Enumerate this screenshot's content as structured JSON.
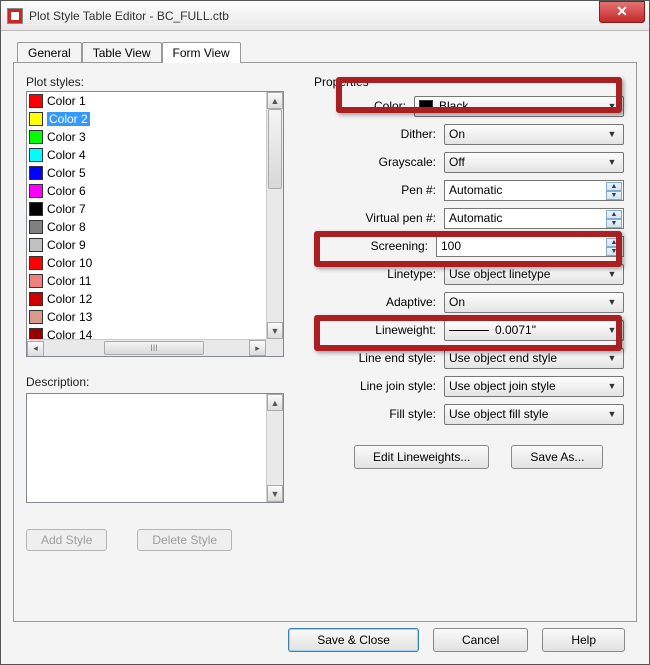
{
  "window": {
    "title": "Plot Style Table Editor - BC_FULL.ctb"
  },
  "tabs": {
    "general": "General",
    "table_view": "Table View",
    "form_view": "Form View"
  },
  "left": {
    "plot_styles_label": "Plot styles:",
    "description_label": "Description:",
    "add_style": "Add Style",
    "delete_style": "Delete Style",
    "items": [
      {
        "name": "Color 1",
        "color": "#ff0000"
      },
      {
        "name": "Color 2",
        "color": "#ffff00"
      },
      {
        "name": "Color 3",
        "color": "#00ff00"
      },
      {
        "name": "Color 4",
        "color": "#00ffff"
      },
      {
        "name": "Color 5",
        "color": "#0000ff"
      },
      {
        "name": "Color 6",
        "color": "#ff00ff"
      },
      {
        "name": "Color 7",
        "color": "#000000"
      },
      {
        "name": "Color 8",
        "color": "#808080"
      },
      {
        "name": "Color 9",
        "color": "#c0c0c0"
      },
      {
        "name": "Color 10",
        "color": "#ff0000"
      },
      {
        "name": "Color 11",
        "color": "#f08080"
      },
      {
        "name": "Color 12",
        "color": "#cc0000"
      },
      {
        "name": "Color 13",
        "color": "#d9998c"
      },
      {
        "name": "Color 14",
        "color": "#990000"
      }
    ],
    "selected_index": 1
  },
  "props": {
    "section_label": "Properties",
    "color_label": "Color:",
    "color_value": "Black",
    "dither_label": "Dither:",
    "dither_value": "On",
    "grayscale_label": "Grayscale:",
    "grayscale_value": "Off",
    "pen_label": "Pen #:",
    "pen_value": "Automatic",
    "vpen_label": "Virtual pen #:",
    "vpen_value": "Automatic",
    "screening_label": "Screening:",
    "screening_value": "100",
    "linetype_label": "Linetype:",
    "linetype_value": "Use object linetype",
    "adaptive_label": "Adaptive:",
    "adaptive_value": "On",
    "lineweight_label": "Lineweight:",
    "lineweight_value": "0.0071\"",
    "endstyle_label": "Line end style:",
    "endstyle_value": "Use object end style",
    "joinstyle_label": "Line join style:",
    "joinstyle_value": "Use object join style",
    "fillstyle_label": "Fill style:",
    "fillstyle_value": "Use object fill style",
    "edit_lw": "Edit Lineweights...",
    "save_as": "Save As..."
  },
  "buttons": {
    "save_close": "Save & Close",
    "cancel": "Cancel",
    "help": "Help"
  },
  "glyphs": {
    "hthumb": "III"
  }
}
